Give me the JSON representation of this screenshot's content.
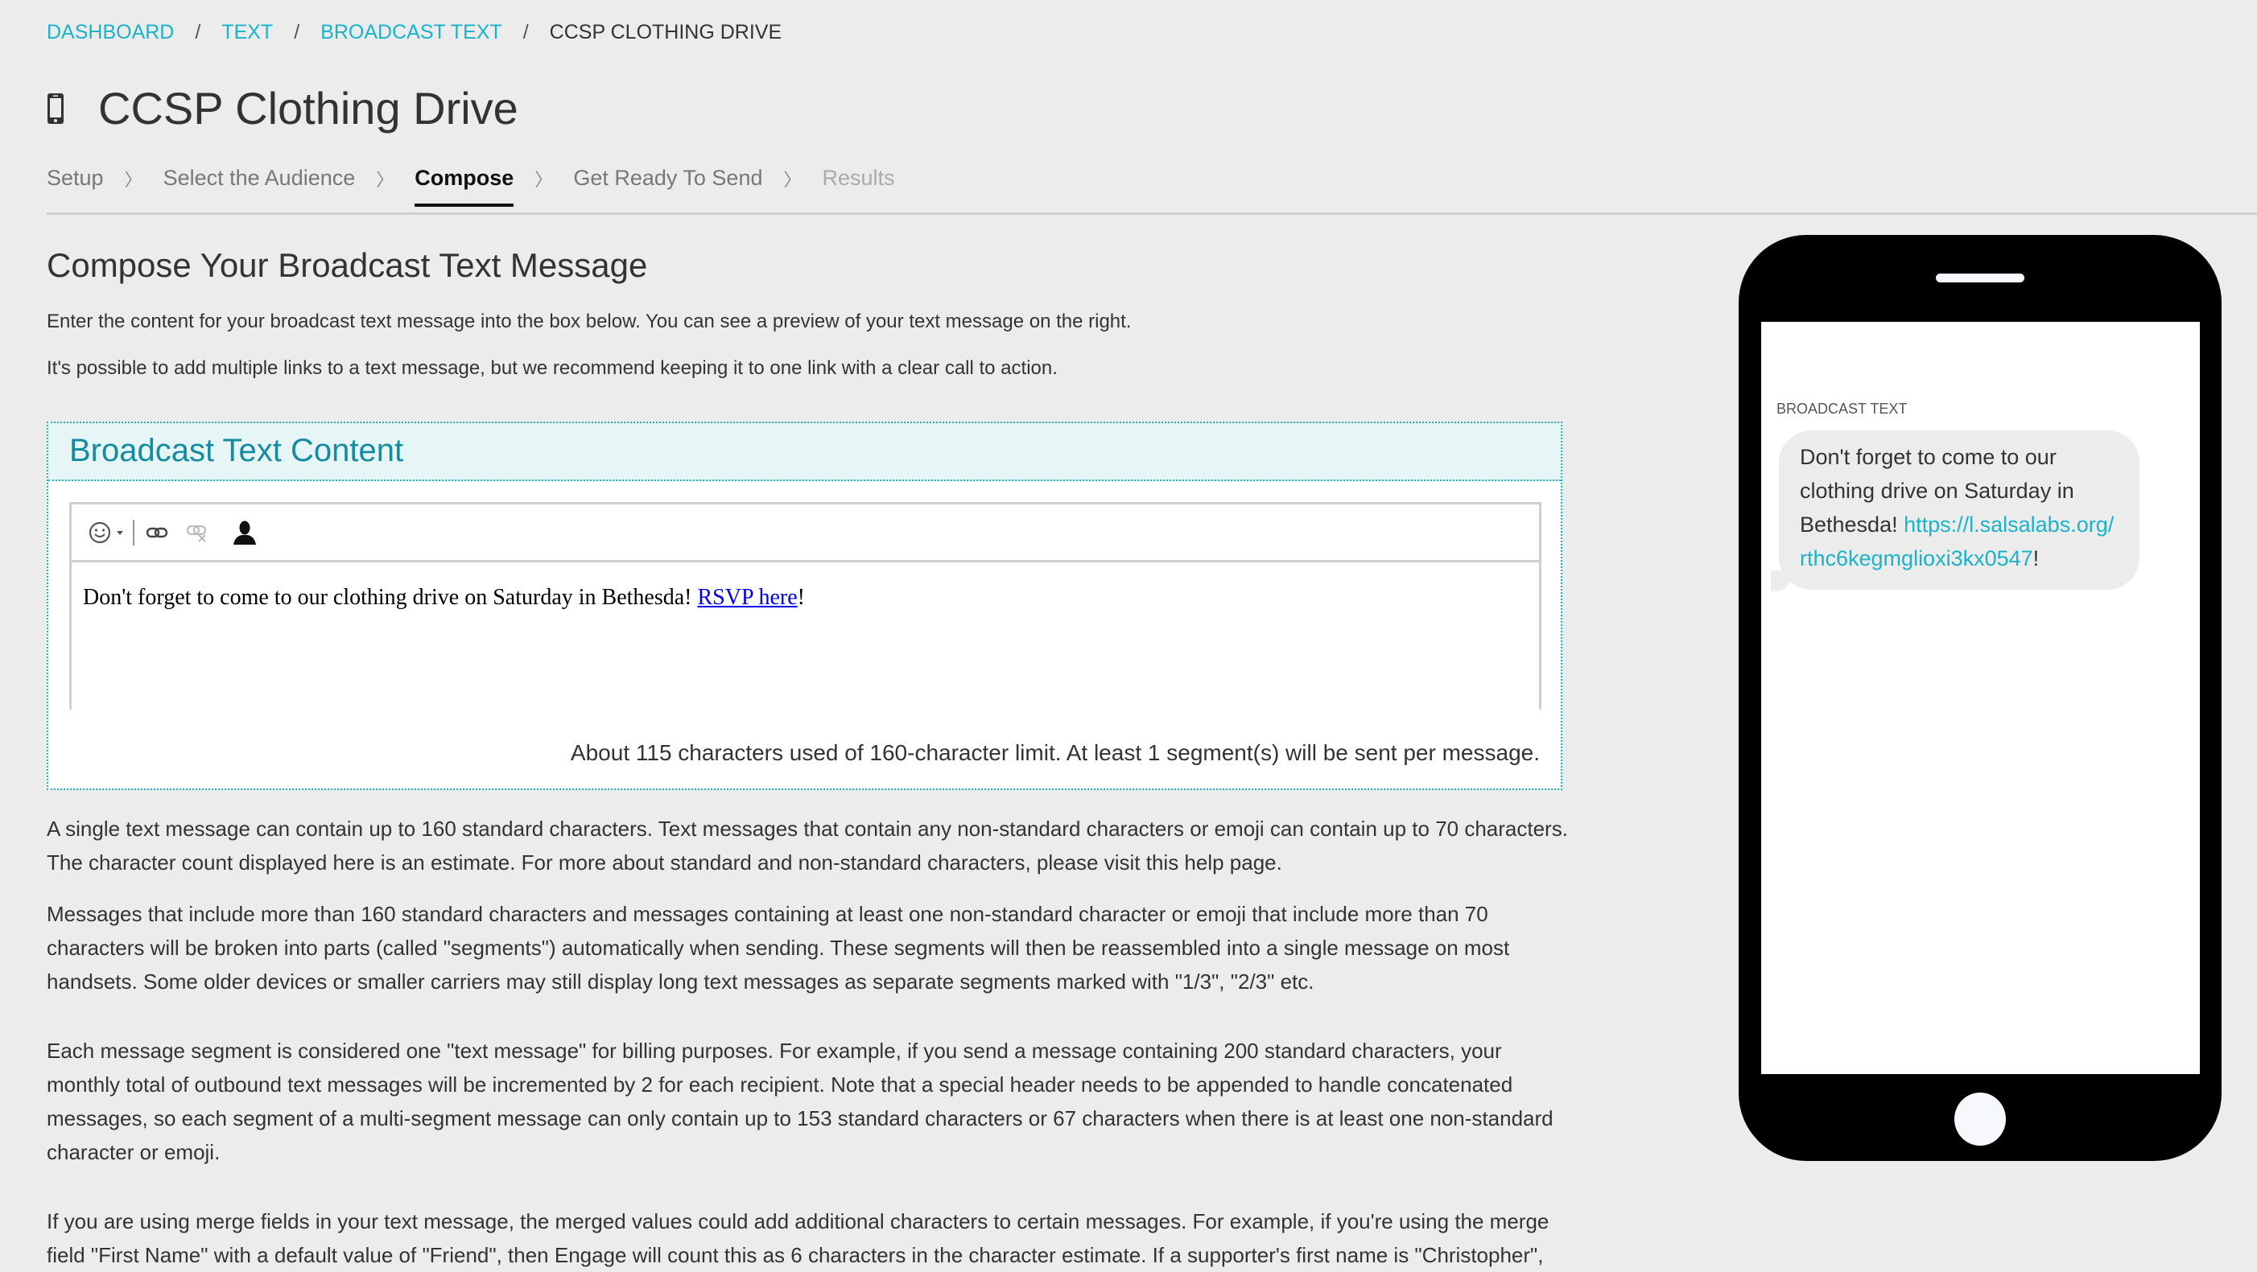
{
  "breadcrumb": {
    "items": [
      {
        "label": "DASHBOARD"
      },
      {
        "label": "TEXT"
      },
      {
        "label": "BROADCAST TEXT"
      }
    ],
    "separator": "/",
    "current": "CCSP CLOTHING DRIVE"
  },
  "header": {
    "icon": "mobile-phone-icon",
    "title": "CCSP Clothing Drive"
  },
  "steps": {
    "items": [
      {
        "label": "Setup",
        "state": "done"
      },
      {
        "label": "Select the Audience",
        "state": "done"
      },
      {
        "label": "Compose",
        "state": "active"
      },
      {
        "label": "Get Ready To Send",
        "state": "upcoming"
      },
      {
        "label": "Results",
        "state": "disabled"
      }
    ],
    "separator": "〉"
  },
  "main": {
    "heading": "Compose Your Broadcast Text Message",
    "intro": [
      "Enter the content for your broadcast text message into the box below. You can see a preview of your text message on the right.",
      "It's possible to add multiple links to a text message, but we recommend keeping it to one link with a clear call to action."
    ],
    "content_box": {
      "title": "Broadcast Text Content",
      "toolbar": {
        "emoji": "emoji-picker-icon",
        "link": "link-icon",
        "unlink": "unlink-icon",
        "merge_field": "person-icon"
      },
      "message_text": "Don't forget to come to our clothing drive on Saturday in Bethesda! ",
      "message_link_text": "RSVP here",
      "message_suffix": "!",
      "char_count": "About 115 characters used of 160-character limit. At least 1 segment(s) will be sent per message."
    },
    "help_paragraphs": [
      "A single text message can contain up to 160 standard characters. Text messages that contain any non-standard characters or emoji can contain up to 70 characters. The character count displayed here is an estimate. For more about standard and non-standard characters, please visit this help page.",
      "Messages that include more than 160 standard characters and messages containing at least one non-standard character or emoji that include more than 70 characters will be broken into parts (called \"segments\") automatically when sending. These segments will then be reassembled into a single message on most handsets. Some older devices or smaller carriers may still display long text messages as separate segments marked with \"1/3\", \"2/3\" etc.",
      "Each message segment is considered one \"text message\" for billing purposes. For example, if you send a message containing 200 standard characters, your monthly total of outbound text messages will be incremented by 2 for each recipient. Note that a special header needs to be appended to handle concatenated messages, so each segment of a multi-segment message can only contain up to 153 standard characters or 67 characters when there is at least one non-standard character or emoji.",
      "If you are using merge fields in your text message, the merged values could add additional characters to certain messages. For example, if you're using the merge field \"First Name\" with a default value of \"Friend\", then Engage will count this as 6 characters in the character estimate. If a supporter's first name is \"Christopher\","
    ]
  },
  "preview": {
    "label": "BROADCAST TEXT",
    "message_text": "Don't forget to come to our clothing drive on Saturday in Bethesda! ",
    "link": "https://l.salsalabs.org/rthc6kegmglioxi3kx0547",
    "suffix": "!"
  },
  "colors": {
    "accent": "#1ab3c8",
    "content_header_bg": "#e6f6f6",
    "content_title": "#158ba0",
    "page_bg": "#ececec",
    "phone_body": "#000000",
    "bubble_bg": "#ececec"
  }
}
